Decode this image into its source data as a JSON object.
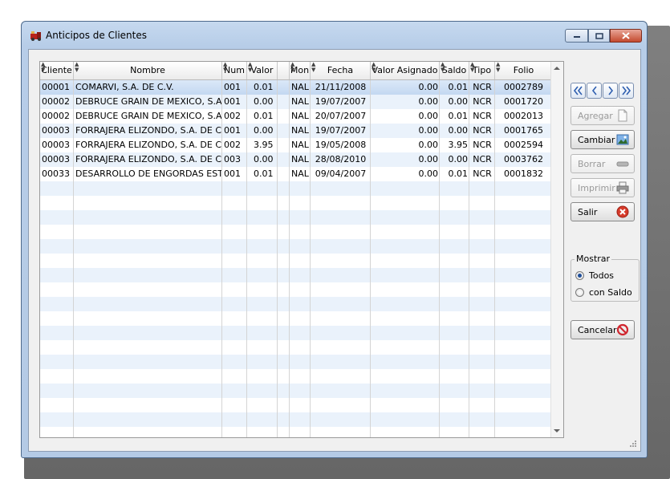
{
  "window": {
    "title": "Anticipos de Clientes"
  },
  "grid": {
    "columns": [
      {
        "key": "cliente",
        "label": "Cliente"
      },
      {
        "key": "nombre",
        "label": "Nombre"
      },
      {
        "key": "num",
        "label": "Num"
      },
      {
        "key": "valor",
        "label": "Valor"
      },
      {
        "key": "blank",
        "label": ""
      },
      {
        "key": "mon",
        "label": "Mon"
      },
      {
        "key": "fecha",
        "label": "Fecha"
      },
      {
        "key": "valor_asignado",
        "label": "Valor Asignado"
      },
      {
        "key": "saldo",
        "label": "Saldo"
      },
      {
        "key": "tipo",
        "label": "Tipo"
      },
      {
        "key": "folio",
        "label": "Folio"
      }
    ],
    "rows": [
      {
        "cliente": "00001",
        "nombre": "COMARVI, S.A. DE C.V.",
        "num": "001",
        "valor": "0.01",
        "mon": "NAL",
        "fecha": "21/11/2008",
        "valor_asignado": "0.00",
        "saldo": "0.01",
        "tipo": "NCR",
        "folio": "0002789"
      },
      {
        "cliente": "00002",
        "nombre": "DEBRUCE GRAIN DE MEXICO, S.A. DE",
        "num": "001",
        "valor": "0.00",
        "mon": "NAL",
        "fecha": "19/07/2007",
        "valor_asignado": "0.00",
        "saldo": "0.00",
        "tipo": "NCR",
        "folio": "0001720"
      },
      {
        "cliente": "00002",
        "nombre": "DEBRUCE GRAIN DE MEXICO, S.A. DE",
        "num": "002",
        "valor": "0.01",
        "mon": "NAL",
        "fecha": "20/07/2007",
        "valor_asignado": "0.00",
        "saldo": "0.01",
        "tipo": "NCR",
        "folio": "0002013"
      },
      {
        "cliente": "00003",
        "nombre": "FORRAJERA ELIZONDO, S.A. DE C.V.",
        "num": "001",
        "valor": "0.00",
        "mon": "NAL",
        "fecha": "19/07/2007",
        "valor_asignado": "0.00",
        "saldo": "0.00",
        "tipo": "NCR",
        "folio": "0001765"
      },
      {
        "cliente": "00003",
        "nombre": "FORRAJERA ELIZONDO, S.A. DE C.V.",
        "num": "002",
        "valor": "3.95",
        "mon": "NAL",
        "fecha": "19/05/2008",
        "valor_asignado": "0.00",
        "saldo": "3.95",
        "tipo": "NCR",
        "folio": "0002594"
      },
      {
        "cliente": "00003",
        "nombre": "FORRAJERA ELIZONDO, S.A. DE C.V.",
        "num": "003",
        "valor": "0.00",
        "mon": "NAL",
        "fecha": "28/08/2010",
        "valor_asignado": "0.00",
        "saldo": "0.00",
        "tipo": "NCR",
        "folio": "0003762"
      },
      {
        "cliente": "00033",
        "nombre": "DESARROLLO DE ENGORDAS ESTABUL",
        "num": "001",
        "valor": "0.01",
        "mon": "NAL",
        "fecha": "09/04/2007",
        "valor_asignado": "0.00",
        "saldo": "0.01",
        "tipo": "NCR",
        "folio": "0001832"
      }
    ]
  },
  "actions": {
    "agregar": "Agregar",
    "cambiar": "Cambiar",
    "borrar": "Borrar",
    "imprimir": "Imprimir",
    "salir": "Salir",
    "cancelar": "Cancelar"
  },
  "mostrar": {
    "legend": "Mostrar",
    "options": [
      {
        "label": "Todos",
        "selected": true
      },
      {
        "label": "con Saldo",
        "selected": false
      }
    ]
  },
  "colors": {
    "selected_row": "#c3d8f1",
    "alt_row": "#eaf2fb",
    "close_red": "#c44a2f"
  }
}
